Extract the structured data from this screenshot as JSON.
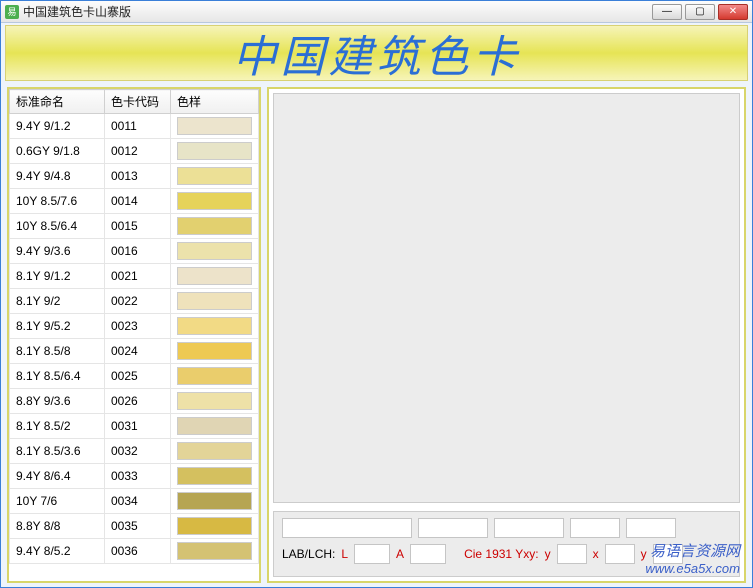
{
  "window": {
    "title": "中国建筑色卡山寨版"
  },
  "banner": {
    "title": "中国建筑色卡"
  },
  "columns": {
    "name": "标准命名",
    "code": "色卡代码",
    "swatch": "色样"
  },
  "rows": [
    {
      "name": "9.4Y 9/1.2",
      "code": "0011",
      "color": "#ece4cd"
    },
    {
      "name": "0.6GY 9/1.8",
      "code": "0012",
      "color": "#e7e4c7"
    },
    {
      "name": "9.4Y 9/4.8",
      "code": "0013",
      "color": "#ece096"
    },
    {
      "name": "10Y 8.5/7.6",
      "code": "0014",
      "color": "#e6d35a"
    },
    {
      "name": "10Y 8.5/6.4",
      "code": "0015",
      "color": "#e2d06f"
    },
    {
      "name": "9.4Y 9/3.6",
      "code": "0016",
      "color": "#ece2ab"
    },
    {
      "name": "8.1Y 9/1.2",
      "code": "0021",
      "color": "#ede3ca"
    },
    {
      "name": "8.1Y 9/2",
      "code": "0022",
      "color": "#efe2bb"
    },
    {
      "name": "8.1Y 9/5.2",
      "code": "0023",
      "color": "#f2da85"
    },
    {
      "name": "8.1Y 8.5/8",
      "code": "0024",
      "color": "#eec953"
    },
    {
      "name": "8.1Y 8.5/6.4",
      "code": "0025",
      "color": "#eacd6c"
    },
    {
      "name": "8.8Y 9/3.6",
      "code": "0026",
      "color": "#eee1a7"
    },
    {
      "name": "8.1Y 8.5/2",
      "code": "0031",
      "color": "#e0d5b4"
    },
    {
      "name": "8.1Y 8.5/3.6",
      "code": "0032",
      "color": "#e3d498"
    },
    {
      "name": "9.4Y 8/6.4",
      "code": "0033",
      "color": "#d4c05f"
    },
    {
      "name": "10Y 7/6",
      "code": "0034",
      "color": "#b6a552"
    },
    {
      "name": "8.8Y 8/8",
      "code": "0035",
      "color": "#d7b943"
    },
    {
      "name": "9.4Y 8/5.2",
      "code": "0036",
      "color": "#d4c273"
    }
  ],
  "info": {
    "lablch_label": "LAB/LCH:",
    "L": "L",
    "A": "A",
    "cie_label": "Cie 1931 Yxy:",
    "y1": "y",
    "x": "x",
    "y2": "y"
  },
  "watermark": {
    "cn": "易语言资源网",
    "url": "www.e5a5x.com"
  }
}
